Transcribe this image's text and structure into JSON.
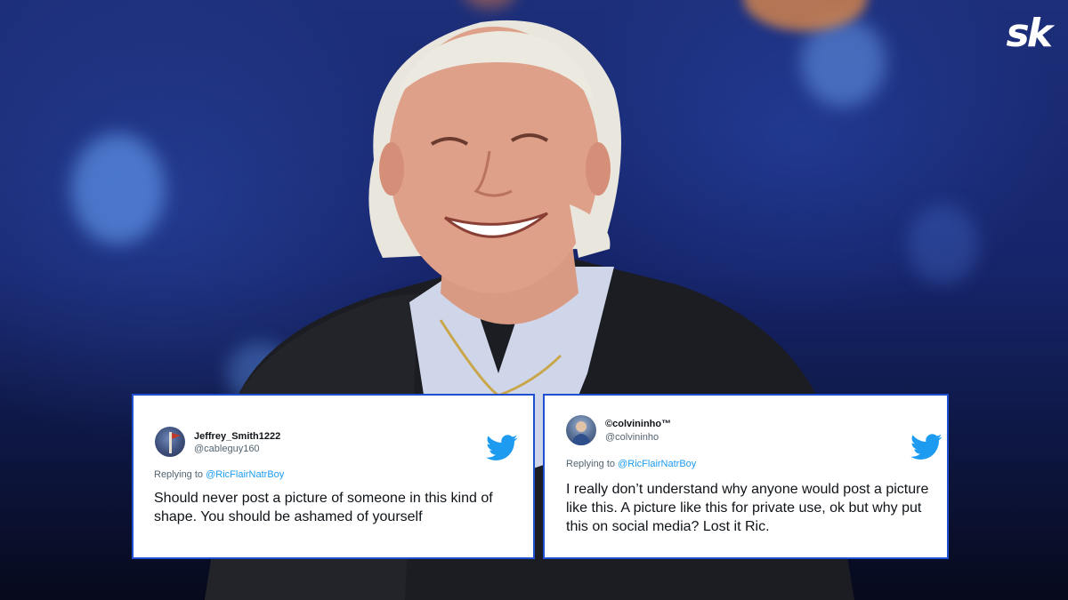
{
  "brand": {
    "logo_text": "sk"
  },
  "tweets": [
    {
      "display_name": "Jeffrey_Smith1222",
      "handle": "@cableguy160",
      "replying_prefix": "Replying to",
      "replying_to": "@RicFlairNatrBoy",
      "text": "Should never post a picture of someone in this kind of shape.  You should be ashamed of yourself",
      "icon": "twitter-bird-icon"
    },
    {
      "display_name": "©colvininho™",
      "handle": "@colvininho",
      "replying_prefix": "Replying to",
      "replying_to": "@RicFlairNatrBoy",
      "text": "I really don’t understand why anyone would post a picture like this. A picture like this for private use, ok but why put this on social media? Lost it Ric.",
      "icon": "twitter-bird-icon"
    }
  ],
  "colors": {
    "twitter_blue": "#1d9bf0",
    "card_border": "#1f4fd1",
    "background": "#1d2f7a"
  }
}
